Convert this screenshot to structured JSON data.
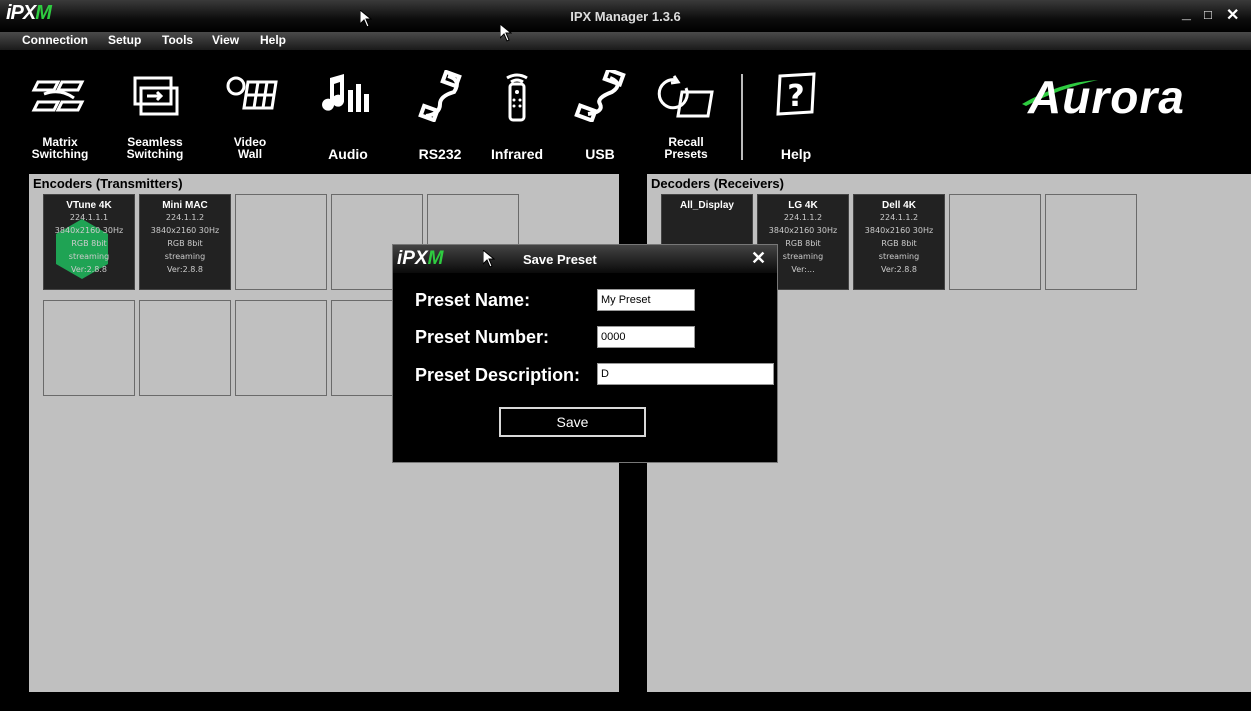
{
  "window": {
    "logo": {
      "ipx": "iPX",
      "m": "M"
    },
    "title": "IPX Manager 1.3.6",
    "controls": {
      "minimize": "_",
      "maximize": "□",
      "close": "✕"
    }
  },
  "menu": [
    "Connection",
    "Setup",
    "Tools",
    "View",
    "Help"
  ],
  "toolbar": [
    {
      "label": "Matrix\nSwitching",
      "icon": "matrix-switching-icon"
    },
    {
      "label": "Seamless\nSwitching",
      "icon": "seamless-switching-icon"
    },
    {
      "label": "Video\nWall",
      "icon": "video-wall-icon"
    },
    {
      "label": "Audio",
      "icon": "audio-icon"
    },
    {
      "label": "RS232",
      "icon": "rs232-icon"
    },
    {
      "label": "Infrared",
      "icon": "infrared-remote-icon"
    },
    {
      "label": "USB",
      "icon": "usb-icon"
    },
    {
      "label": "Recall\nPresets",
      "icon": "recall-presets-icon"
    },
    {
      "label": "Help",
      "icon": "help-icon"
    }
  ],
  "brand": "Aurora",
  "encoders": {
    "title": "Encoders (Transmitters)",
    "devices": [
      {
        "name": "VTune 4K",
        "ip": "224.1.1.1",
        "res": "3840x2160 30Hz",
        "color": "RGB 8bit",
        "status": "streaming",
        "ver": "Ver:2.8.8"
      },
      {
        "name": "Mini MAC",
        "ip": "224.1.1.2",
        "res": "3840x2160 30Hz",
        "color": "RGB 8bit",
        "status": "streaming",
        "ver": "Ver:2.8.8"
      }
    ]
  },
  "decoders": {
    "title": "Decoders (Receivers)",
    "devices": [
      {
        "name": "All_Display"
      },
      {
        "name": "LG 4K",
        "ip": "224.1.1.2",
        "res": "3840x2160 30Hz",
        "color": "RGB 8bit",
        "status": "streaming",
        "ver": "Ver:..."
      },
      {
        "name": "Dell 4K",
        "ip": "224.1.1.2",
        "res": "3840x2160 30Hz",
        "color": "RGB 8bit",
        "status": "streaming",
        "ver": "Ver:2.8.8"
      }
    ]
  },
  "dialog": {
    "title": "Save Preset",
    "close": "✕",
    "name_label": "Preset Name:",
    "name_value": "My Preset",
    "number_label": "Preset Number:",
    "number_value": "0000",
    "desc_label": "Preset Description:",
    "desc_value": "D",
    "save_label": "Save"
  }
}
